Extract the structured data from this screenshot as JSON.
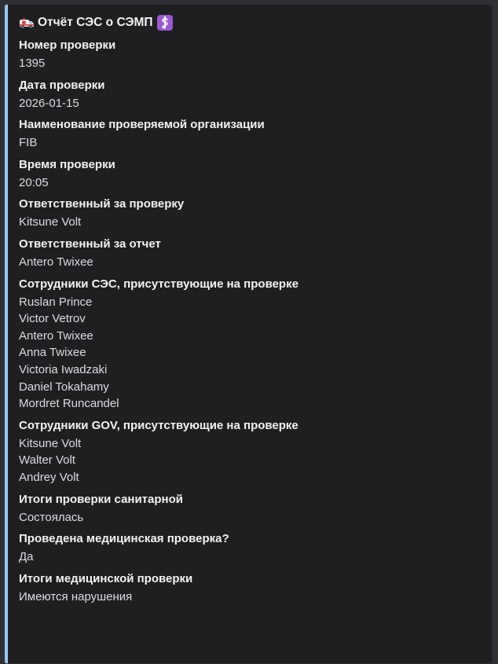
{
  "report": {
    "title": "Отчёт СЭС о СЭМП",
    "title_icons": [
      "ambulance-icon",
      "medical-symbol-icon"
    ],
    "accent_color": "#9bc9f4",
    "fields": [
      {
        "name": "Номер проверки",
        "value": "1395"
      },
      {
        "name": "Дата проверки",
        "value": "2026-01-15"
      },
      {
        "name": "Наименование проверяемой организации",
        "value": "FIB"
      },
      {
        "name": "Время проверки",
        "value": "20:05"
      },
      {
        "name": "Ответственный за проверку",
        "value": "Kitsune Volt"
      },
      {
        "name": "Ответственный за отчет",
        "value": "Antero Twixee"
      },
      {
        "name": "Сотрудники СЭС, присутствующие на проверке",
        "value": "Ruslan Prince\nVictor Vetrov\nAntero Twixee\nAnna Twixee\nVictoria Iwadzaki\nDaniel Tokahamy\nMordret Runcandel"
      },
      {
        "name": "Сотрудники GOV, присутствующие на проверке",
        "value": "Kitsune Volt\nWalter Volt\nAndrey Volt"
      },
      {
        "name": "Итоги проверки санитарной",
        "value": "Состоялась"
      },
      {
        "name": "Проведена медицинская проверка?",
        "value": "Да"
      },
      {
        "name": "Итоги медицинской проверки",
        "value": "Имеются нарушения"
      }
    ]
  }
}
